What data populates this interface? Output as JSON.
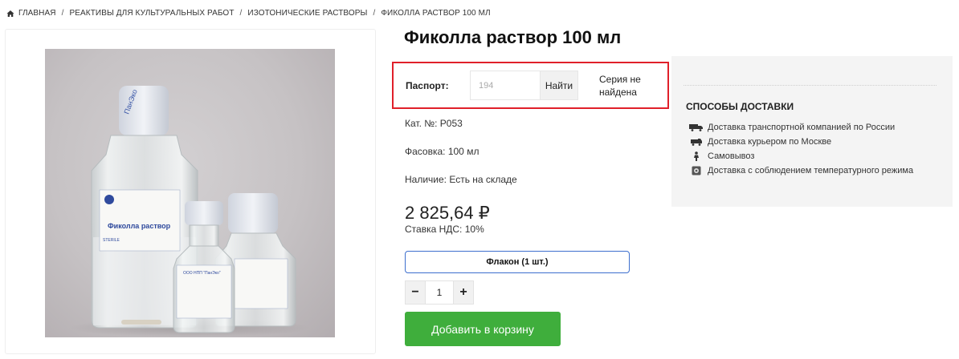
{
  "breadcrumb": [
    "Главная",
    "Реактивы для культуральных работ",
    "Изотонические растворы",
    "Фиколла раствор 100 мл"
  ],
  "product": {
    "title": "Фиколла раствор 100 мл",
    "passport": {
      "label": "Паспорт:",
      "input_value": "194",
      "button_label": "Найти",
      "status": "Серия не найдена"
    },
    "cat_no": "Кат. №: P053",
    "package": "Фасовка: 100 мл",
    "availability": "Наличие: Есть на складе",
    "price": "2 825,64 ₽",
    "vat": "Ставка НДС: 10%",
    "pack_option": "Флакон (1 шт.)",
    "quantity": "1",
    "qty_minus": "−",
    "qty_plus": "+",
    "add_to_cart": "Добавить в корзину"
  },
  "image_labels": {
    "big_label": "Фиколла раствор",
    "small_label": "ООО НПП \"ПанЭко\"",
    "sterile": "STERILE",
    "cap_brand": "ПанЭко"
  },
  "delivery": {
    "title": "Способы доставки",
    "items": [
      {
        "icon": "truck-icon",
        "label": "Доставка транспортной компанией по России"
      },
      {
        "icon": "van-icon",
        "label": "Доставка курьером по Москве"
      },
      {
        "icon": "pickup-person-icon",
        "label": "Самовывоз"
      },
      {
        "icon": "thermometer-box-icon",
        "label": "Доставка с соблюдением температурного режима"
      }
    ]
  },
  "colors": {
    "accent_green": "#3fae3c",
    "highlight_red": "#e0202a",
    "option_blue": "#3d6fce"
  }
}
